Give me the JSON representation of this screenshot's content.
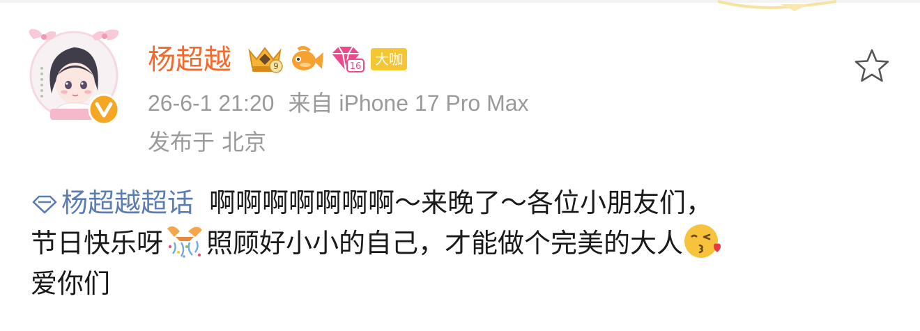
{
  "post": {
    "username": "杨超越",
    "vip_label": "大咖",
    "timestamp": "26-6-1 21:20",
    "source": "来自 iPhone 17 Pro Max",
    "location": "发布于 北京",
    "topic": "杨超越超话",
    "text_line1": "啊啊啊啊啊啊啊～来晚了～各位小朋友们，",
    "text_line2a": "节日快乐呀",
    "text_line2b": "照顾好小小的自己，才能做个完美的大人",
    "text_line3": "爱你们"
  },
  "badges": {
    "crown_level": "9",
    "gem_level": "16"
  },
  "icons": {
    "star": "star-outline-icon",
    "topic": "topic-diamond-icon",
    "verified": "verified-v-icon"
  },
  "colors": {
    "username": "#f26a2e",
    "meta": "#9a9a9a",
    "topic": "#5b7db1",
    "vip_badge": "#f5c534",
    "verified": "#f5a623"
  }
}
